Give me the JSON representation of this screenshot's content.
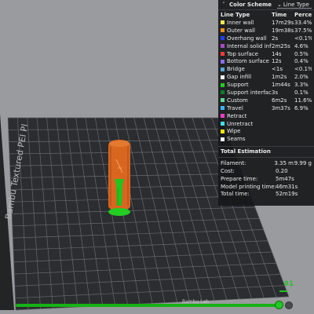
{
  "legend": {
    "title": "Color Scheme",
    "view_type": "Line Type",
    "columns": {
      "line_type": "Line Type",
      "time": "Time",
      "percent": "Percent"
    },
    "rows": [
      {
        "name": "Inner wall",
        "time": "17m29s",
        "percent": "33.4%",
        "color": "#ffe84d"
      },
      {
        "name": "Outer wall",
        "time": "19m38s",
        "percent": "37.5%",
        "color": "#ff8c1a"
      },
      {
        "name": "Overhang wall",
        "time": "2s",
        "percent": "<0.1%",
        "color": "#1f3fff"
      },
      {
        "name": "Internal solid infill",
        "time": "2m25s",
        "percent": "4.6%",
        "color": "#a64ac8"
      },
      {
        "name": "Top surface",
        "time": "14s",
        "percent": "0.5%",
        "color": "#ff3a3a"
      },
      {
        "name": "Bottom surface",
        "time": "12s",
        "percent": "0.4%",
        "color": "#8a6cff"
      },
      {
        "name": "Bridge",
        "time": "<1s",
        "percent": "<0.1%",
        "color": "#5aa7d6"
      },
      {
        "name": "Gap infill",
        "time": "1m2s",
        "percent": "2.0%",
        "color": "#ffffff"
      },
      {
        "name": "Support",
        "time": "1m44s",
        "percent": "3.3%",
        "color": "#22cc22"
      },
      {
        "name": "Support interface",
        "time": "3s",
        "percent": "0.1%",
        "color": "#0e7a2a"
      },
      {
        "name": "Custom",
        "time": "6m2s",
        "percent": "11.6%",
        "color": "#5fd89a"
      },
      {
        "name": "Travel",
        "time": "3m37s",
        "percent": "6.9%",
        "color": "#3bb3ff"
      },
      {
        "name": "Retract",
        "time": "",
        "percent": "",
        "color": "#ff3cc8"
      },
      {
        "name": "Unretract",
        "time": "",
        "percent": "",
        "color": "#42dfe6"
      },
      {
        "name": "Wipe",
        "time": "",
        "percent": "",
        "color": "#ffe600"
      },
      {
        "name": "Seams",
        "time": "",
        "percent": "",
        "color": "#f2f2f2"
      }
    ],
    "totals_title": "Total Estimation",
    "totals": [
      {
        "label": "Filament:",
        "value": "3.35 m",
        "value2": "9.99 g"
      },
      {
        "label": "Cost:",
        "value": "0.20",
        "value2": ""
      },
      {
        "label": "Prepare time:",
        "value": "5m47s",
        "value2": ""
      },
      {
        "label": "Model printing time:",
        "value": "46m31s",
        "value2": ""
      },
      {
        "label": "Total time:",
        "value": "52m19s",
        "value2": ""
      }
    ]
  },
  "plate": {
    "side_text": "Bambu Textured PEI Pl",
    "bottom_text": "Bambu Lab"
  },
  "layer_slider": {
    "current_label": "01"
  },
  "colors": {
    "plate": "#2a2c2f",
    "grid": "#6c6f73",
    "model": "#d9651f",
    "support": "#22cc22"
  }
}
